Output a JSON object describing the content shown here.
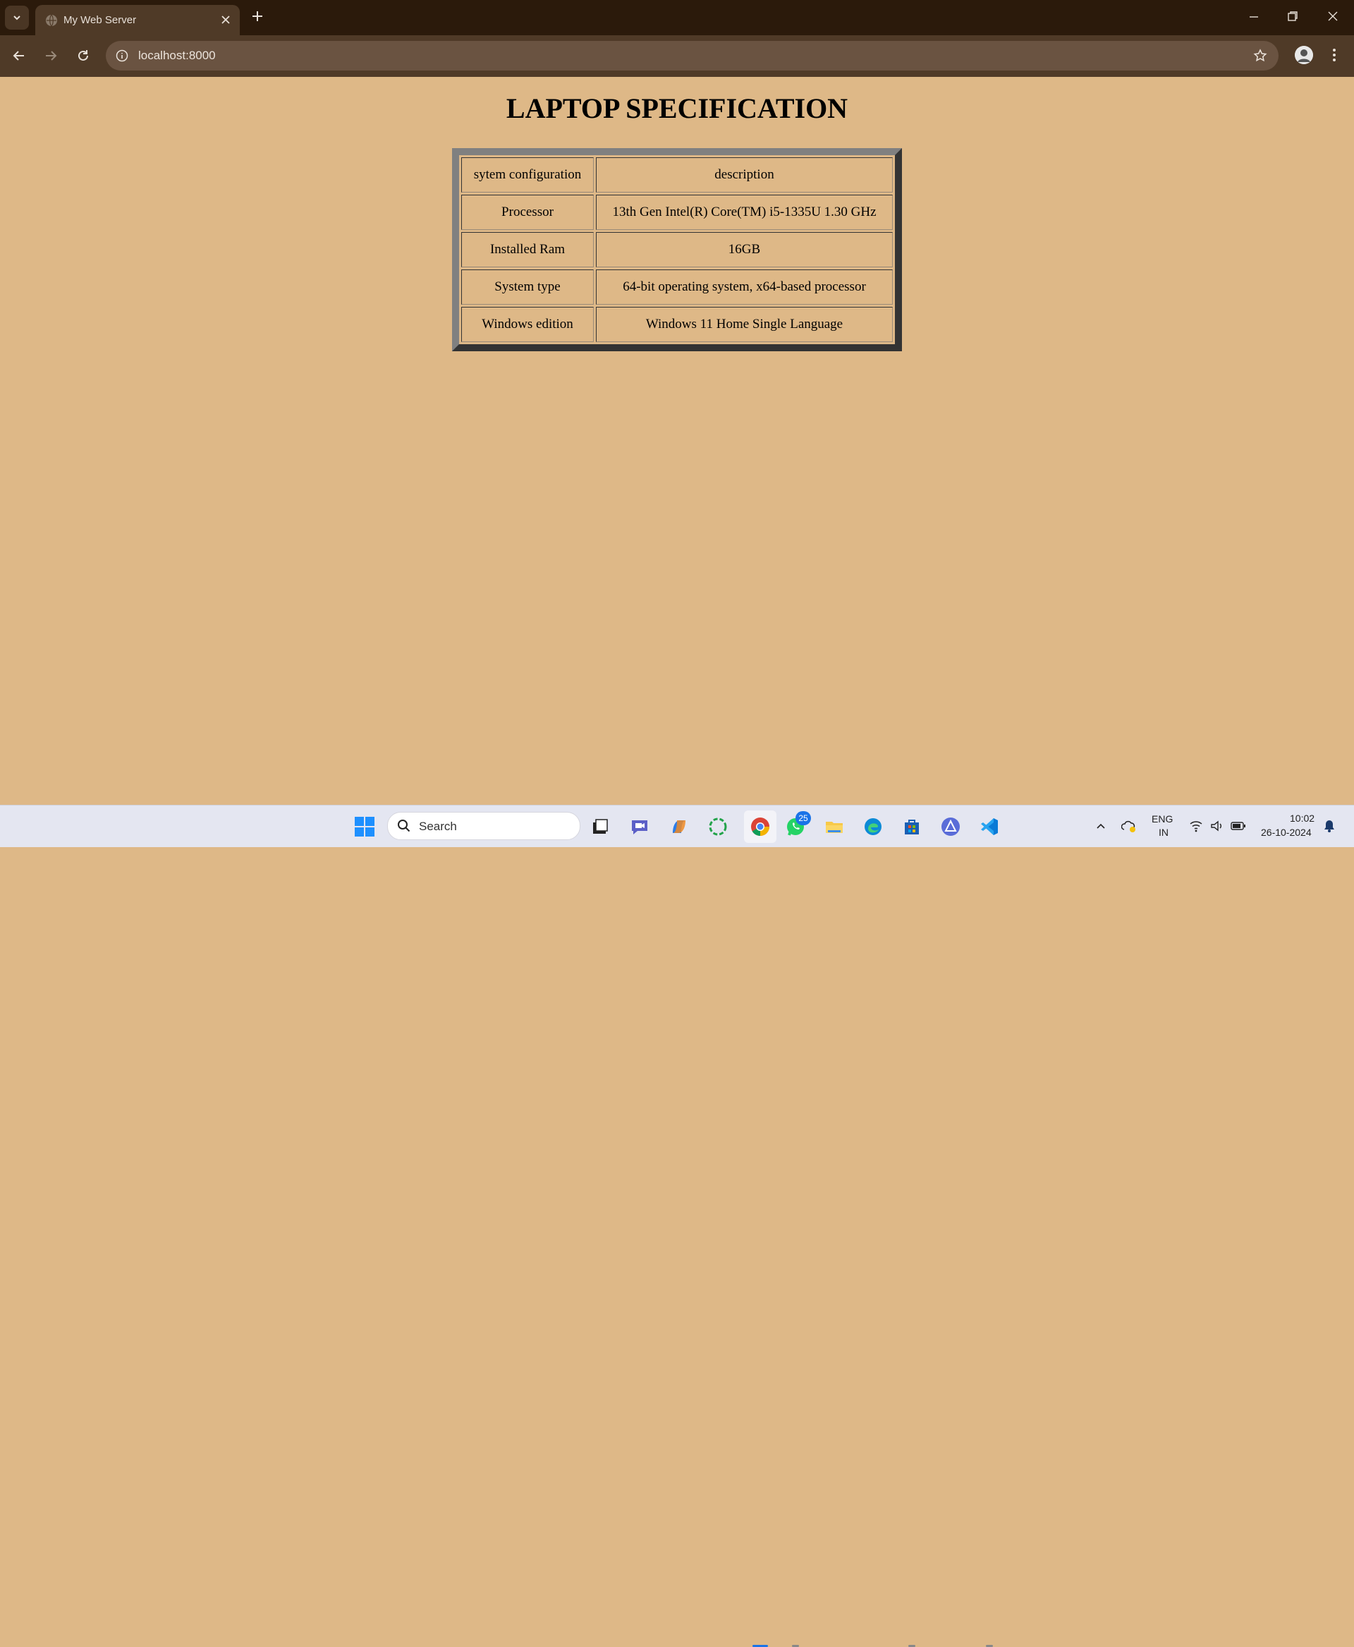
{
  "browser": {
    "tab_title": "My Web Server",
    "url": "localhost:8000"
  },
  "page": {
    "title": "LAPTOP SPECIFICATION",
    "table": {
      "rows": [
        [
          "sytem configuration",
          "description"
        ],
        [
          "Processor",
          "13th Gen Intel(R) Core(TM) i5-1335U 1.30 GHz"
        ],
        [
          "Installed Ram",
          "16GB"
        ],
        [
          "System type",
          "64-bit operating system, x64-based processor"
        ],
        [
          "Windows edition",
          "Windows 11 Home Single Language"
        ]
      ]
    },
    "background": "#deb887"
  },
  "taskbar": {
    "search_label": "Search",
    "whatsapp_badge": "25",
    "lang_line1": "ENG",
    "lang_line2": "IN",
    "time": "10:02",
    "date": "26-10-2024"
  }
}
